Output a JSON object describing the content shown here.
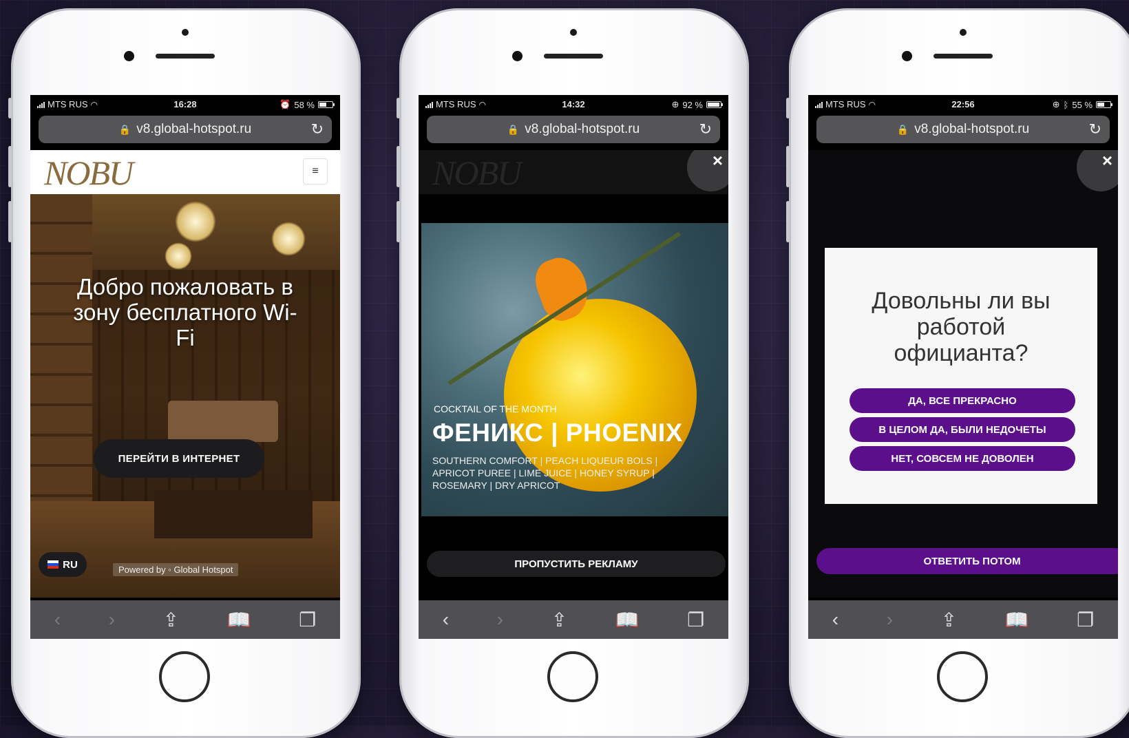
{
  "phones": [
    {
      "status": {
        "carrier": "MTS RUS",
        "time": "16:28",
        "battery": "58 %",
        "battery_level": 0.58,
        "status_icons": [
          "alarm-icon"
        ]
      },
      "url": "v8.global-hotspot.ru",
      "logo": "NOBU",
      "welcome": "Добро пожаловать в зону бесплатного Wi-Fi",
      "cta": "ПЕРЕЙТИ В ИНТЕРНЕТ",
      "language": "RU",
      "powered_by": "Powered by  ◦ Global Hotspot",
      "toolbar": {
        "back_enabled": false,
        "forward_enabled": false
      }
    },
    {
      "status": {
        "carrier": "MTS RUS",
        "time": "14:32",
        "battery": "92 %",
        "battery_level": 0.92,
        "status_icons": [
          "orientation-lock-icon"
        ]
      },
      "url": "v8.global-hotspot.ru",
      "logo": "NOBU",
      "close": "×",
      "ad": {
        "subtitle": "COCKTAIL OF THE MONTH",
        "title": "ФЕНИКС | PHOENIX",
        "description": "SOUTHERN COMFORT | PEACH LIQUEUR BOLS | APRICOT PUREE | LIME JUICE | HONEY SYRUP | ROSEMARY | DRY APRICOT"
      },
      "skip": "ПРОПУСТИТЬ РЕКЛАМУ",
      "toolbar": {
        "back_enabled": true,
        "forward_enabled": false
      }
    },
    {
      "status": {
        "carrier": "MTS RUS",
        "time": "22:56",
        "battery": "55 %",
        "battery_level": 0.55,
        "status_icons": [
          "orientation-lock-icon",
          "bluetooth-icon"
        ]
      },
      "url": "v8.global-hotspot.ru",
      "close": "×",
      "survey": {
        "question": "Довольны ли вы работой официанта?",
        "options": [
          "ДА, ВСЕ ПРЕКРАСНО",
          "В ЦЕЛОМ ДА, БЫЛИ НЕДОЧЕТЫ",
          "НЕТ, СОВСЕМ НЕ ДОВОЛЕН"
        ]
      },
      "later": "ОТВЕТИТЬ ПОТОМ",
      "toolbar": {
        "back_enabled": true,
        "forward_enabled": false
      }
    }
  ],
  "toolbar_icons": [
    "back-icon",
    "forward-icon",
    "share-icon",
    "bookmarks-icon",
    "tabs-icon"
  ],
  "colors": {
    "accent_purple": "#5c0f8b",
    "logo_gold": "#8a6b3e",
    "url_bar": "#555558"
  }
}
